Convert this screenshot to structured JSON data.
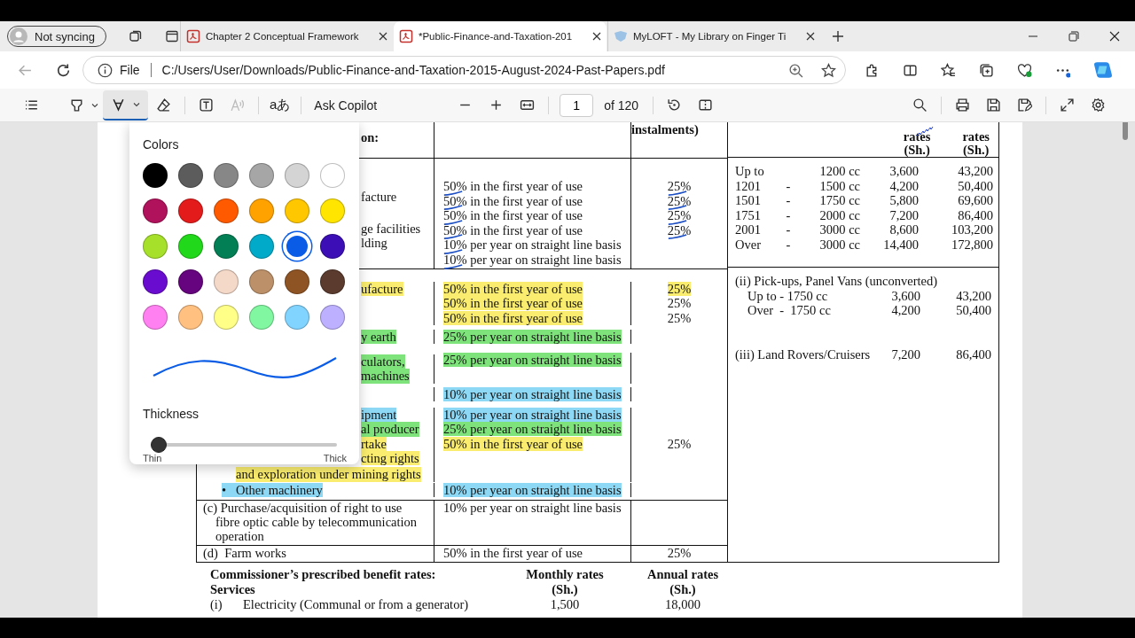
{
  "browser": {
    "profile": "Not syncing",
    "tabs": [
      {
        "title": "Chapter 2 Conceptual Framework",
        "selected": false,
        "kind": "pdf"
      },
      {
        "title": "*Public-Finance-and-Taxation-201",
        "selected": true,
        "kind": "pdf"
      },
      {
        "title": "MyLOFT - My Library on Finger Ti",
        "selected": false,
        "kind": "site"
      }
    ],
    "address": {
      "scheme": "File",
      "url": "C:/Users/User/Downloads/Public-Finance-and-Taxation-2015-August-2024-Past-Papers.pdf"
    }
  },
  "pdf_toolbar": {
    "draw_selected": true,
    "read_aloud_disabled": true,
    "translate": "aあ",
    "ask": "Ask Copilot",
    "page": "1",
    "page_count": "of 120"
  },
  "ink_menu": {
    "title": "Colors",
    "colors": [
      {
        "color": "#000000",
        "selected": false
      },
      {
        "color": "#5c5c5c",
        "selected": false
      },
      {
        "color": "#878787",
        "selected": false
      },
      {
        "color": "#a6a6a6",
        "selected": false
      },
      {
        "color": "#d4d4d4",
        "selected": false
      },
      {
        "color": "#ffffff",
        "selected": false
      },
      {
        "color": "#b0125b",
        "selected": false
      },
      {
        "color": "#e41b1b",
        "selected": false
      },
      {
        "color": "#ff5a00",
        "selected": false
      },
      {
        "color": "#ffa200",
        "selected": false
      },
      {
        "color": "#ffc700",
        "selected": false
      },
      {
        "color": "#ffe500",
        "selected": false
      },
      {
        "color": "#a6e02a",
        "selected": false
      },
      {
        "color": "#22d81a",
        "selected": false
      },
      {
        "color": "#037f56",
        "selected": false
      },
      {
        "color": "#00aac8",
        "selected": false
      },
      {
        "color": "#0a5ce6",
        "selected": true
      },
      {
        "color": "#3b0fb5",
        "selected": false
      },
      {
        "color": "#6a0cd0",
        "selected": false
      },
      {
        "color": "#66037e",
        "selected": false
      },
      {
        "color": "#f4d8c8",
        "selected": false
      },
      {
        "color": "#bc9068",
        "selected": false
      },
      {
        "color": "#8f5424",
        "selected": false
      },
      {
        "color": "#5a3b2e",
        "selected": false
      },
      {
        "color": "#ff80f0",
        "selected": false
      },
      {
        "color": "#ffc080",
        "selected": false
      },
      {
        "color": "#ffff88",
        "selected": false
      },
      {
        "color": "#80f7a0",
        "selected": false
      },
      {
        "color": "#80d4ff",
        "selected": false
      },
      {
        "color": "#bcb0ff",
        "selected": false
      }
    ],
    "thickness_label": "Thickness",
    "thickness": {
      "level": 0.03
    },
    "min_label": "Thin",
    "max_label": "Thick"
  },
  "document": {
    "table": {
      "header": {
        "col1": "on:",
        "col3": "instalments)",
        "col4": [
          {
            "line1": "rates",
            "line2": "(Sh.)"
          },
          {
            "line1": "rates",
            "line2": "(Sh.)"
          }
        ]
      },
      "row_a": {
        "col1": [
          "facture",
          "ge facilities",
          "lding"
        ],
        "col2": [
          {
            "text": "50% in the first year of use",
            "pen_mark": true
          },
          {
            "text": "50% in the first year of use",
            "pen_mark": true
          },
          {
            "text": "50% in the first year of use",
            "pen_mark": true
          },
          {
            "text": "50% in the first year of use",
            "pen_mark": true
          },
          {
            "text": "10% per year on straight line basis",
            "pen_mark": true
          },
          {
            "text": "10% per year on straight line basis",
            "pen_mark": true
          }
        ],
        "col3": [
          {
            "text": "25%",
            "pen_mark": true
          },
          {
            "text": "25%",
            "pen_mark": true
          },
          {
            "text": "25%",
            "pen_mark": true
          },
          {
            "text": "25%",
            "pen_mark": true
          }
        ],
        "col4": [
          {
            "from": "Up to",
            "to": "1200 cc",
            "monthly": "3,600",
            "annual": "43,200"
          },
          {
            "from": "1201",
            "dash": "-",
            "to": "1500 cc",
            "monthly": "4,200",
            "annual": "50,400"
          },
          {
            "from": "1501",
            "dash": "-",
            "to": "1750 cc",
            "monthly": "5,800",
            "annual": "69,600"
          },
          {
            "from": "1751",
            "dash": "-",
            "to": "2000 cc",
            "monthly": "7,200",
            "annual": "86,400"
          },
          {
            "from": "2001",
            "dash": "-",
            "to": "3000 cc",
            "monthly": "8,600",
            "annual": "103,200"
          },
          {
            "from": "Over",
            "dash": "-",
            "to": "3000 cc",
            "monthly": "14,400",
            "annual": "172,800"
          }
        ]
      },
      "row_b": [
        {
          "col1": [
            {
              "text": "ufacture",
              "covered": true,
              "color": "#f9ec6e"
            }
          ],
          "col2": {
            "text": "50% in the first year of use",
            "color": "#f9ec6e"
          },
          "col3": {
            "text": "25%",
            "color": "#f9ec6e"
          }
        },
        {
          "col2": {
            "text": "50% in the first year of use",
            "color": "#f9ec6e"
          },
          "col3": {
            "text": "25%"
          }
        },
        {
          "col2": {
            "text": "50% in the first year of use",
            "color": "#f9ec6e"
          },
          "col3": {
            "text": "25%"
          }
        },
        {
          "col1": [
            {
              "text": "y earth",
              "covered": true,
              "color": "#7ee37a"
            }
          ],
          "col2": {
            "text": "25% per year on straight line basis",
            "color": "#7ee37a"
          }
        },
        {
          "col1": [
            {
              "text": "culators,",
              "covered": true,
              "color": "#7ee37a"
            },
            {
              "text": "machines",
              "covered": true,
              "color": "#7ee37a"
            }
          ],
          "col2": {
            "text": "25% per year on straight line basis",
            "color": "#7ee37a"
          }
        },
        {
          "col2": {
            "text": "10% per year on straight line basis",
            "color": "#8dd8f5"
          }
        },
        {
          "col1": [
            {
              "text": "ipment",
              "covered": true,
              "color": "#8dd8f5"
            }
          ],
          "col2": {
            "text": "10% per year on straight line basis",
            "color": "#8dd8f5"
          }
        },
        {
          "col1": [
            {
              "text": "al producer",
              "covered": true,
              "color": "#7ee37a"
            }
          ],
          "col2": {
            "text": "25% per year on straight line basis",
            "color": "#7ee37a"
          }
        },
        {
          "col1": [
            {
              "text": "rtake",
              "covered": true,
              "color": "#f9ec6e"
            },
            {
              "text": "cting rights",
              "covered": true,
              "color": "#f9ec6e"
            },
            {
              "text": "and exploration under mining rights",
              "covered": false,
              "color": "#f9ec6e"
            }
          ],
          "col2": {
            "text": "50% in the first year of use",
            "color": "#f9ec6e"
          },
          "col3": {
            "text": "25%"
          }
        },
        {
          "col1": [
            {
              "text": "Other machinery",
              "covered": false,
              "bullet": "•",
              "color": "#8dd8f5"
            }
          ],
          "col2": {
            "text": "10% per year on straight line basis",
            "color": "#8dd8f5"
          }
        }
      ],
      "row_c": {
        "col1": [
          "(c) Purchase/acquisition of right to use",
          "fibre optic cable by telecommunication",
          "operation"
        ],
        "col2": "10% per year on straight line basis"
      },
      "row_d": {
        "col1": "(d)  Farm works",
        "col2": "50% in the first year of use",
        "col3": "25%"
      },
      "col4_lower": [
        {
          "kind": "heading",
          "text": "(ii) Pick-ups, Panel Vans (unconverted)"
        },
        {
          "kind": "sub_rate",
          "label": "Up to - 1750 cc",
          "monthly": "3,600",
          "annual": "43,200"
        },
        {
          "kind": "sub_rate",
          "label": "Over  -  1750 cc",
          "monthly": "4,200",
          "annual": "50,400"
        },
        {
          "kind": "rate",
          "label": "(iii) Land Rovers/Cruisers",
          "monthly": "7,200",
          "annual": "86,400"
        }
      ]
    },
    "benefits": {
      "title": "Commissioner’s prescribed benefit rates:",
      "subtitle": "Services",
      "columns": [
        {
          "line1": "Monthly rates",
          "line2": "(Sh.)"
        },
        {
          "line1": "Annual rates",
          "line2": "(Sh.)"
        }
      ],
      "rows": [
        {
          "index": "(i)",
          "label": "Electricity (Communal or from a generator)",
          "monthly": "1,500",
          "annual": "18,000"
        }
      ]
    }
  }
}
